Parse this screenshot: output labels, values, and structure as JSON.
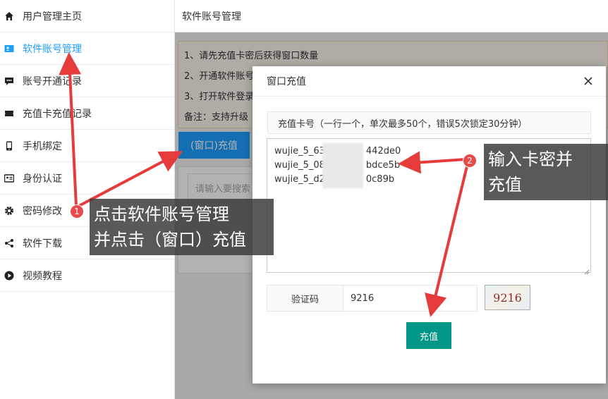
{
  "sidebar": {
    "items": [
      {
        "label": "用户管理主页",
        "icon": "home-icon"
      },
      {
        "label": "软件账号管理",
        "icon": "id-card-icon",
        "active": true
      },
      {
        "label": "账号开通记录",
        "icon": "chat-dots-icon"
      },
      {
        "label": "充值卡充值记录",
        "icon": "ticket-icon"
      },
      {
        "label": "手机绑定",
        "icon": "phone-icon"
      },
      {
        "label": "身份认证",
        "icon": "identity-icon"
      },
      {
        "label": "密码修改",
        "icon": "gear-icon"
      },
      {
        "label": "软件下载",
        "icon": "share-icon"
      },
      {
        "label": "视频教程",
        "icon": "play-circle-icon"
      }
    ]
  },
  "header": {
    "title": "软件账号管理"
  },
  "notice": {
    "lines": [
      "1、请先充值卡密后获得窗口数量",
      "2、开通软件账号",
      "3、打开软件登录",
      "备注：支持升级"
    ]
  },
  "main": {
    "recharge_button": "(窗口)充值",
    "search_placeholder": "请输入要搜索"
  },
  "modal": {
    "title": "窗口充值",
    "card_label": "充值卡号（一行一个，单次最多50个，错误5次锁定30分钟）",
    "cards": [
      {
        "prefix": "wujie_5_63",
        "suffix": "442de0"
      },
      {
        "prefix": "wujie_5_08",
        "suffix": "bdce5b"
      },
      {
        "prefix": "wujie_5_d2",
        "suffix": "0c89b"
      }
    ],
    "vcode_label": "验证码",
    "vcode_value": "9216",
    "captcha_text": "9216",
    "submit": "充值"
  },
  "annotations": {
    "callout1": [
      "点击软件账号管理",
      "并点击（窗口）充值"
    ],
    "callout2": [
      "输入卡密并",
      "充值"
    ],
    "badge1": "1",
    "badge2": "2",
    "arrow_color": "#e63b3b"
  },
  "colors": {
    "accent": "#1e9fff",
    "primary": "#009688"
  }
}
